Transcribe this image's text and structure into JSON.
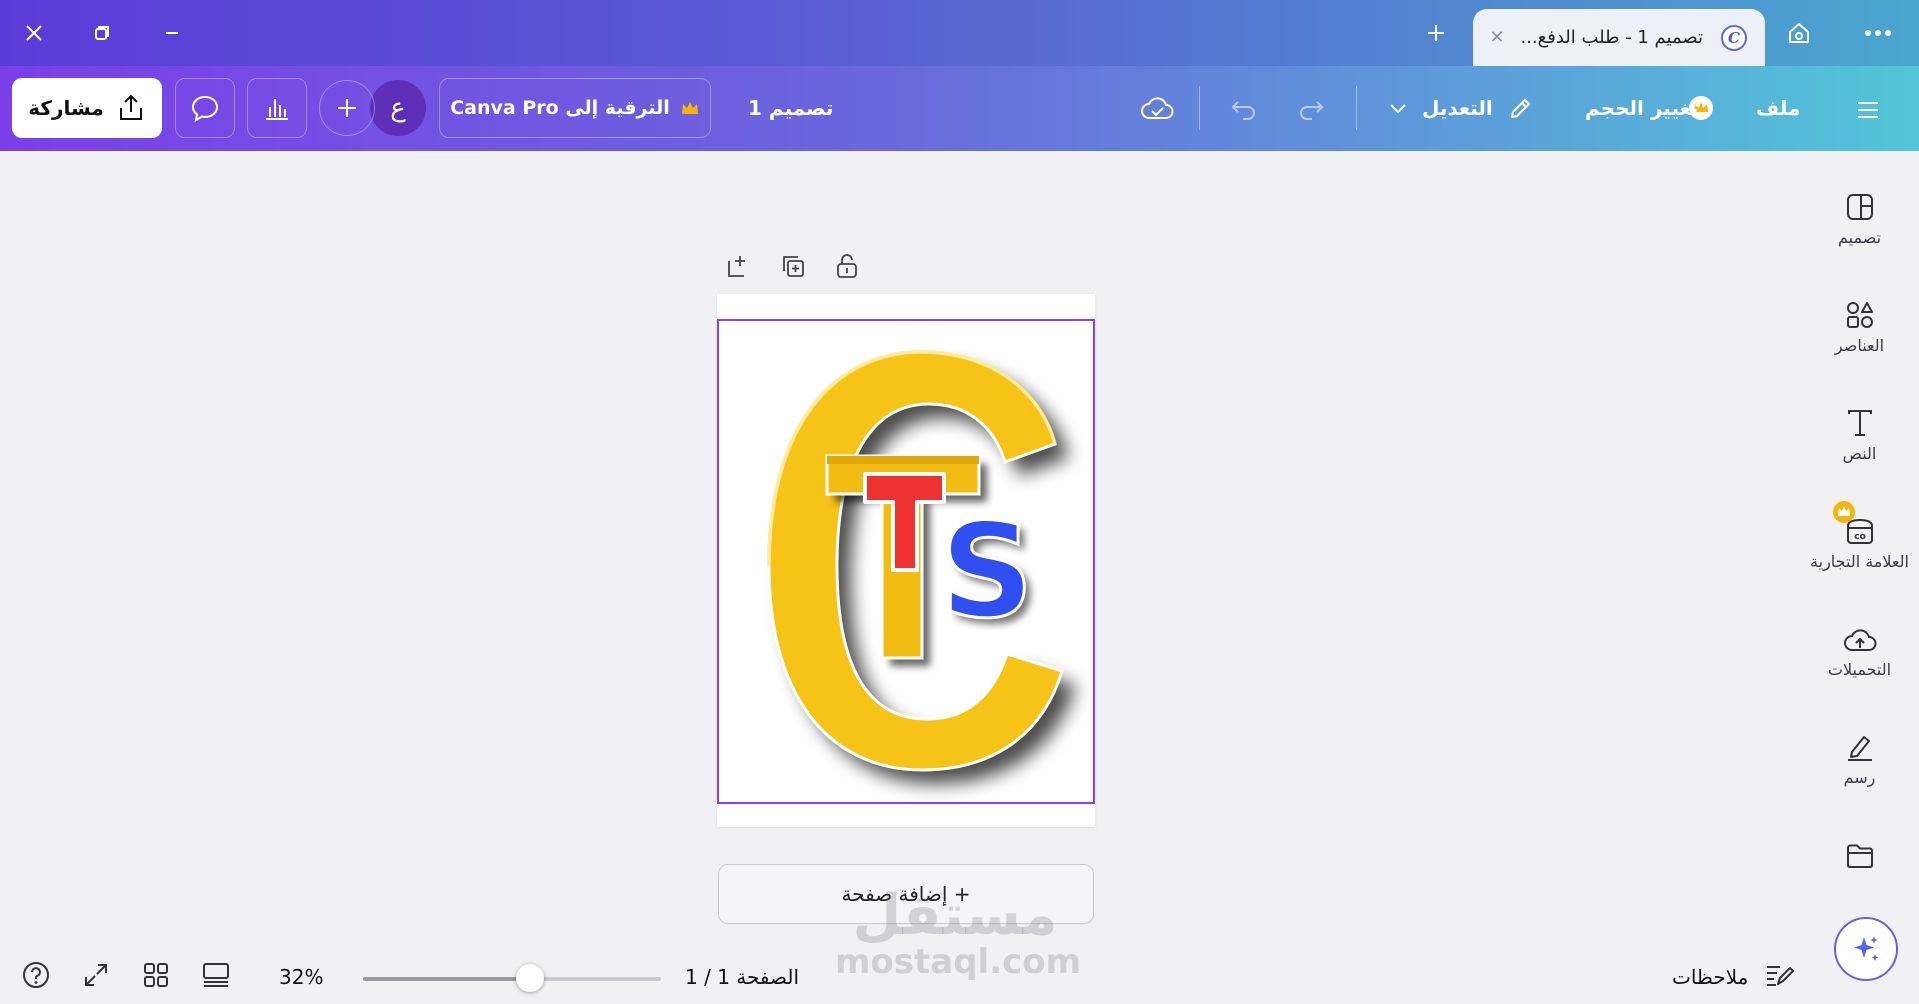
{
  "window": {
    "tab_title": "تصميم 1 - طلب الدفع...",
    "tab_logo_letter": "C"
  },
  "toolbar": {
    "file_label": "ملف",
    "resize_label": "تغيير الحجم",
    "edit_label": "التعديل",
    "design_name": "تصميم 1",
    "upgrade_label": "الترقية إلى Canva Pro",
    "avatar_letter": "ع",
    "share_label": "مشاركة"
  },
  "sidebar": {
    "items": [
      {
        "label": "تصميم",
        "icon": "design-icon"
      },
      {
        "label": "العناصر",
        "icon": "elements-icon"
      },
      {
        "label": "النص",
        "icon": "text-icon"
      },
      {
        "label": "العلامة التجارية",
        "icon": "brand-icon"
      },
      {
        "label": "التحميلات",
        "icon": "uploads-icon"
      },
      {
        "label": "رسم",
        "icon": "draw-icon"
      },
      {
        "label": "",
        "icon": "projects-icon"
      }
    ]
  },
  "canvas": {
    "add_page_label": "+ إضافة صفحة",
    "logo_letters": {
      "outer": "C",
      "red": "T",
      "blue": "S"
    }
  },
  "footer": {
    "notes_label": "ملاحظات",
    "page_indicator": "الصفحة 1 / 1",
    "zoom": "32%",
    "zoom_fraction": 0.56
  },
  "watermark": {
    "arabic": "مستقل",
    "latin": "mostaql.com"
  },
  "colors": {
    "accent_purple": "#8b3dff",
    "logo_yellow": "#f6c416",
    "logo_red": "#ee3131",
    "logo_blue": "#2f4ff0",
    "crown": "#f5b50a"
  }
}
